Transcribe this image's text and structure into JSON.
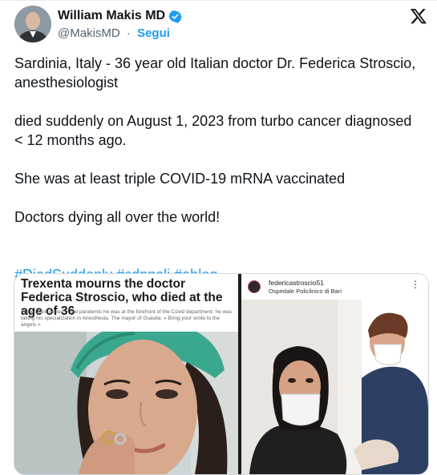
{
  "author": {
    "name": "William Makis MD",
    "handle": "@MakisMD",
    "separator": "·",
    "follow_label": "Segui"
  },
  "tweet": {
    "paragraphs": [
      "Sardinia, Italy - 36 year old Italian doctor Dr. Federica Stroscio, anesthesiologist",
      "died suddenly on August 1, 2023 from turbo cancer diagnosed < 12 months ago.",
      "She was at least triple COVID-19 mRNA vaccinated",
      "Doctors dying all over the world!"
    ],
    "hashtags": [
      "#DiedSuddenly",
      "#cdnpoli",
      "#ableg"
    ]
  },
  "media": {
    "left": {
      "headline": "Trexenta mourns the doctor Federica Stroscio, who died at the age of 36",
      "subtext": "In the black period of the pandemic he was at the forefront of the Covid department: he was taking his specialization in Anesthesia. The mayor of Guasila: « Bring your smile to the angels »"
    },
    "right": {
      "username": "federicastroscio51",
      "location": "Ospedale Policlinico di Bari",
      "menu": "⋮"
    }
  },
  "colors": {
    "accent": "#1d9bf0",
    "text": "#0f1419",
    "muted": "#536471"
  },
  "icons": [
    "verified-badge-icon",
    "x-logo-icon",
    "more-options-icon"
  ]
}
